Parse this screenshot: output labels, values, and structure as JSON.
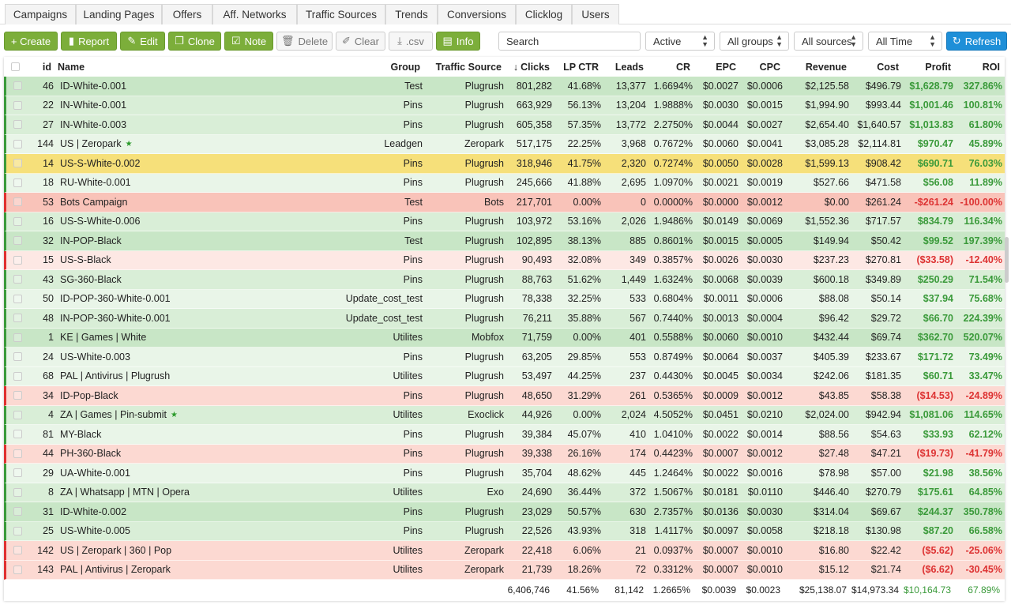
{
  "tabs": [
    "Campaigns",
    "Landing Pages",
    "Offers",
    "Aff. Networks",
    "Traffic Sources",
    "Trends",
    "Conversions",
    "Clicklog",
    "Users"
  ],
  "toolbar": {
    "create": "+ Create",
    "report": "Report",
    "edit": "Edit",
    "clone": "Clone",
    "note": "Note",
    "delete": "Delete",
    "clear": "Clear",
    "csv": ".csv",
    "info": "Info",
    "search_placeholder": "Search",
    "status": "Active",
    "groups": "All groups",
    "sources": "All sources",
    "time": "All Time",
    "refresh": "Refresh"
  },
  "colors": {
    "green_btn": "#7cae3a",
    "blue_btn": "#1e8fd8",
    "selected_row": "#f6e07a",
    "profit_pos": "#3a9a3a",
    "profit_neg": "#d33333"
  },
  "table": {
    "columns": [
      "id",
      "Name",
      "Group",
      "Traffic Source",
      "Clicks",
      "LP CTR",
      "Leads",
      "CR",
      "EPC",
      "CPC",
      "Revenue",
      "Cost",
      "Profit",
      "ROI"
    ],
    "sort_indicator": "↓",
    "rows": [
      [
        "46",
        "ID-White-0.001",
        "Test",
        "Plugrush",
        "801,282",
        "41.68%",
        "13,377",
        "1.6694%",
        "$0.0027",
        "$0.0006",
        "$2,125.58",
        "$496.79",
        "$1,628.79",
        "327.86%"
      ],
      [
        "22",
        "IN-White-0.001",
        "Pins",
        "Plugrush",
        "663,929",
        "56.13%",
        "13,204",
        "1.9888%",
        "$0.0030",
        "$0.0015",
        "$1,994.90",
        "$993.44",
        "$1,001.46",
        "100.81%"
      ],
      [
        "27",
        "IN-White-0.003",
        "Pins",
        "Plugrush",
        "605,358",
        "57.35%",
        "13,772",
        "2.2750%",
        "$0.0044",
        "$0.0027",
        "$2,654.40",
        "$1,640.57",
        "$1,013.83",
        "61.80%"
      ],
      [
        "144",
        "US | Zeropark",
        "Leadgen",
        "Zeropark",
        "517,175",
        "22.25%",
        "3,968",
        "0.7672%",
        "$0.0060",
        "$0.0041",
        "$3,085.28",
        "$2,114.81",
        "$970.47",
        "45.89%"
      ],
      [
        "14",
        "US-S-White-0.002",
        "Pins",
        "Plugrush",
        "318,946",
        "41.75%",
        "2,320",
        "0.7274%",
        "$0.0050",
        "$0.0028",
        "$1,599.13",
        "$908.42",
        "$690.71",
        "76.03%"
      ],
      [
        "18",
        "RU-White-0.001",
        "Pins",
        "Plugrush",
        "245,666",
        "41.88%",
        "2,695",
        "1.0970%",
        "$0.0021",
        "$0.0019",
        "$527.66",
        "$471.58",
        "$56.08",
        "11.89%"
      ],
      [
        "53",
        "Bots Campaign",
        "Test",
        "Bots",
        "217,701",
        "0.00%",
        "0",
        "0.0000%",
        "$0.0000",
        "$0.0012",
        "$0.00",
        "$261.24",
        "-$261.24",
        "-100.00%"
      ],
      [
        "16",
        "US-S-White-0.006",
        "Pins",
        "Plugrush",
        "103,972",
        "53.16%",
        "2,026",
        "1.9486%",
        "$0.0149",
        "$0.0069",
        "$1,552.36",
        "$717.57",
        "$834.79",
        "116.34%"
      ],
      [
        "32",
        "IN-POP-Black",
        "Test",
        "Plugrush",
        "102,895",
        "38.13%",
        "885",
        "0.8601%",
        "$0.0015",
        "$0.0005",
        "$149.94",
        "$50.42",
        "$99.52",
        "197.39%"
      ],
      [
        "15",
        "US-S-Black",
        "Pins",
        "Plugrush",
        "90,493",
        "32.08%",
        "349",
        "0.3857%",
        "$0.0026",
        "$0.0030",
        "$237.23",
        "$270.81",
        "($33.58)",
        "-12.40%"
      ],
      [
        "43",
        "SG-360-Black",
        "Pins",
        "Plugrush",
        "88,763",
        "51.62%",
        "1,449",
        "1.6324%",
        "$0.0068",
        "$0.0039",
        "$600.18",
        "$349.89",
        "$250.29",
        "71.54%"
      ],
      [
        "50",
        "ID-POP-360-White-0.001",
        "Update_cost_test",
        "Plugrush",
        "78,338",
        "32.25%",
        "533",
        "0.6804%",
        "$0.0011",
        "$0.0006",
        "$88.08",
        "$50.14",
        "$37.94",
        "75.68%"
      ],
      [
        "48",
        "IN-POP-360-White-0.001",
        "Update_cost_test",
        "Plugrush",
        "76,211",
        "35.88%",
        "567",
        "0.7440%",
        "$0.0013",
        "$0.0004",
        "$96.42",
        "$29.72",
        "$66.70",
        "224.39%"
      ],
      [
        "1",
        "KE | Games | White",
        "Utilites",
        "Mobfox",
        "71,759",
        "0.00%",
        "401",
        "0.5588%",
        "$0.0060",
        "$0.0010",
        "$432.44",
        "$69.74",
        "$362.70",
        "520.07%"
      ],
      [
        "24",
        "US-White-0.003",
        "Pins",
        "Plugrush",
        "63,205",
        "29.85%",
        "553",
        "0.8749%",
        "$0.0064",
        "$0.0037",
        "$405.39",
        "$233.67",
        "$171.72",
        "73.49%"
      ],
      [
        "68",
        "PAL | Antivirus | Plugrush",
        "Utilites",
        "Plugrush",
        "53,497",
        "44.25%",
        "237",
        "0.4430%",
        "$0.0045",
        "$0.0034",
        "$242.06",
        "$181.35",
        "$60.71",
        "33.47%"
      ],
      [
        "34",
        "ID-Pop-Black",
        "Pins",
        "Plugrush",
        "48,650",
        "31.29%",
        "261",
        "0.5365%",
        "$0.0009",
        "$0.0012",
        "$43.85",
        "$58.38",
        "($14.53)",
        "-24.89%"
      ],
      [
        "4",
        "ZA | Games | Pin-submit",
        "Utilites",
        "Exoclick",
        "44,926",
        "0.00%",
        "2,024",
        "4.5052%",
        "$0.0451",
        "$0.0210",
        "$2,024.00",
        "$942.94",
        "$1,081.06",
        "114.65%"
      ],
      [
        "81",
        "MY-Black",
        "Pins",
        "Plugrush",
        "39,384",
        "45.07%",
        "410",
        "1.0410%",
        "$0.0022",
        "$0.0014",
        "$88.56",
        "$54.63",
        "$33.93",
        "62.12%"
      ],
      [
        "44",
        "PH-360-Black",
        "Pins",
        "Plugrush",
        "39,338",
        "26.16%",
        "174",
        "0.4423%",
        "$0.0007",
        "$0.0012",
        "$27.48",
        "$47.21",
        "($19.73)",
        "-41.79%"
      ],
      [
        "29",
        "UA-White-0.001",
        "Pins",
        "Plugrush",
        "35,704",
        "48.62%",
        "445",
        "1.2464%",
        "$0.0022",
        "$0.0016",
        "$78.98",
        "$57.00",
        "$21.98",
        "38.56%"
      ],
      [
        "8",
        "ZA | Whatsapp | MTN | Opera",
        "Utilites",
        "Exo",
        "24,690",
        "36.44%",
        "372",
        "1.5067%",
        "$0.0181",
        "$0.0110",
        "$446.40",
        "$270.79",
        "$175.61",
        "64.85%"
      ],
      [
        "31",
        "ID-White-0.002",
        "Pins",
        "Plugrush",
        "23,029",
        "50.57%",
        "630",
        "2.7357%",
        "$0.0136",
        "$0.0030",
        "$314.04",
        "$69.67",
        "$244.37",
        "350.78%"
      ],
      [
        "25",
        "US-White-0.005",
        "Pins",
        "Plugrush",
        "22,526",
        "43.93%",
        "318",
        "1.4117%",
        "$0.0097",
        "$0.0058",
        "$218.18",
        "$130.98",
        "$87.20",
        "66.58%"
      ],
      [
        "142",
        "US | Zeropark | 360 | Pop",
        "Utilites",
        "Zeropark",
        "22,418",
        "6.06%",
        "21",
        "0.0937%",
        "$0.0007",
        "$0.0010",
        "$16.80",
        "$22.42",
        "($5.62)",
        "-25.06%"
      ],
      [
        "143",
        "PAL | Antivirus | Zeropark",
        "Utilites",
        "Zeropark",
        "21,739",
        "18.26%",
        "72",
        "0.3312%",
        "$0.0007",
        "$0.0010",
        "$15.12",
        "$21.74",
        "($6.62)",
        "-30.45%"
      ]
    ],
    "row_shade": [
      "g3",
      "g2",
      "g2",
      "g1",
      "sel",
      "g1",
      "r3",
      "g2",
      "g3",
      "r1",
      "g2",
      "g1",
      "g2",
      "g3",
      "g1",
      "g1",
      "r2",
      "g2",
      "g1",
      "r2",
      "g1",
      "g2",
      "g3",
      "g2",
      "r2",
      "r2"
    ],
    "starred": [
      "144",
      "4"
    ],
    "totals": [
      "",
      "",
      "",
      "",
      "6,406,746",
      "41.56%",
      "81,142",
      "1.2665%",
      "$0.0039",
      "$0.0023",
      "$25,138.07",
      "$14,973.34",
      "$10,164.73",
      "67.89%"
    ]
  }
}
